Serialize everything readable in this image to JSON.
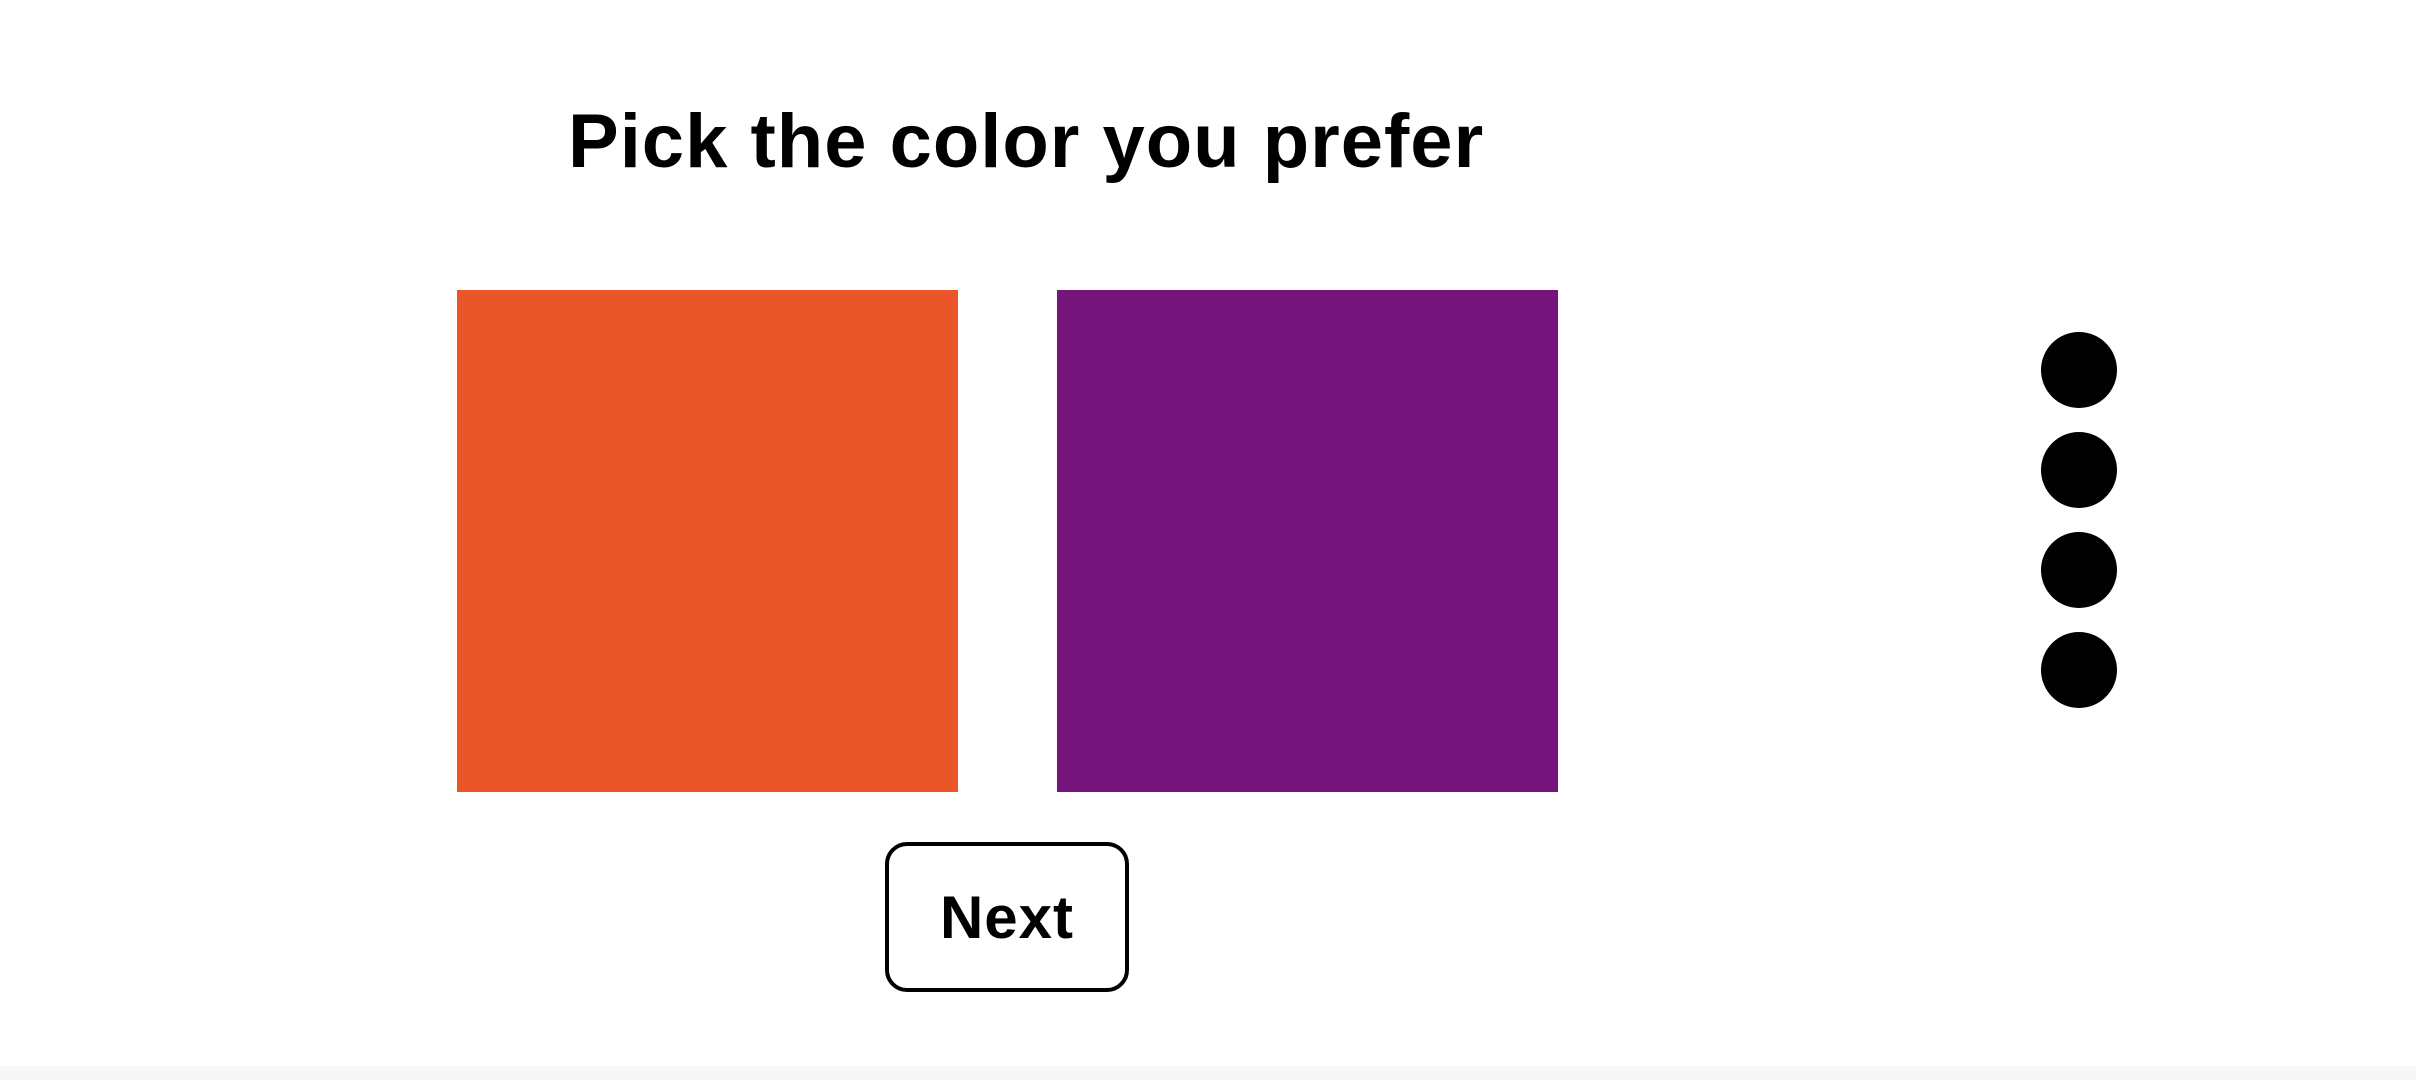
{
  "prompt": {
    "title": "Pick the color you prefer"
  },
  "choices": [
    {
      "color": "#EB5629"
    },
    {
      "color": "#75147B"
    }
  ],
  "actions": {
    "next_label": "Next"
  },
  "progress": {
    "dot_count": 4
  }
}
